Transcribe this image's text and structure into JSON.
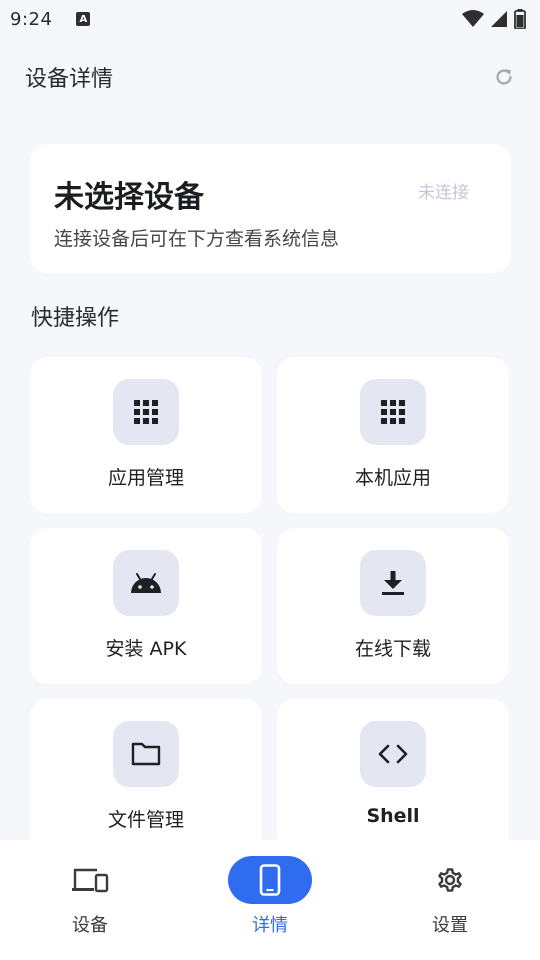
{
  "status_bar": {
    "time": "9:24",
    "app_icon_letter": "A",
    "icons": [
      "wifi-icon",
      "signal-icon",
      "battery-icon"
    ]
  },
  "header": {
    "title": "设备详情",
    "refresh_icon": "refresh-icon"
  },
  "device_card": {
    "name": "未选择设备",
    "hint": "连接设备后可在下方查看系统信息",
    "status": "未连接"
  },
  "quick_actions": {
    "title": "快捷操作",
    "items": [
      {
        "label": "应用管理",
        "icon": "grid-icon"
      },
      {
        "label": "本机应用",
        "icon": "grid-icon"
      },
      {
        "label": "安装 APK",
        "icon": "android-icon"
      },
      {
        "label": "在线下载",
        "icon": "download-icon"
      },
      {
        "label": "文件管理",
        "icon": "folder-icon"
      },
      {
        "label": "Shell",
        "icon": "code-icon"
      }
    ]
  },
  "bottom_nav": {
    "items": [
      {
        "label": "设备",
        "icon": "devices-icon",
        "active": false
      },
      {
        "label": "详情",
        "icon": "phone-icon",
        "active": true
      },
      {
        "label": "设置",
        "icon": "gear-icon",
        "active": false
      }
    ]
  },
  "colors": {
    "accent": "#2f6cf0",
    "background": "#f6f7fb",
    "card": "#ffffff",
    "icon_box": "#e4e7f1",
    "muted_status": "#c3c8d6"
  }
}
